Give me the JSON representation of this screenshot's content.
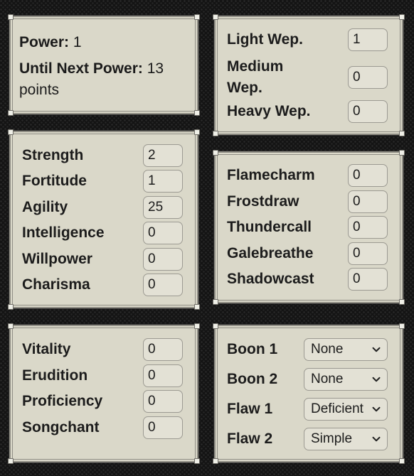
{
  "power_panel": {
    "power_label": "Power:",
    "power_value": "1",
    "next_label": "Until Next Power:",
    "next_value": "13 points"
  },
  "weapons_panel": {
    "items": [
      {
        "label": "Light Wep.",
        "value": "1"
      },
      {
        "label": "Medium Wep.",
        "value": "0"
      },
      {
        "label": "Heavy Wep.",
        "value": "0"
      }
    ]
  },
  "attributes_panel": {
    "items": [
      {
        "label": "Strength",
        "value": "2"
      },
      {
        "label": "Fortitude",
        "value": "1"
      },
      {
        "label": "Agility",
        "value": "25"
      },
      {
        "label": "Intelligence",
        "value": "0"
      },
      {
        "label": "Willpower",
        "value": "0"
      },
      {
        "label": "Charisma",
        "value": "0"
      }
    ]
  },
  "magic_panel": {
    "items": [
      {
        "label": "Flamecharm",
        "value": "0"
      },
      {
        "label": "Frostdraw",
        "value": "0"
      },
      {
        "label": "Thundercall",
        "value": "0"
      },
      {
        "label": "Galebreathe",
        "value": "0"
      },
      {
        "label": "Shadowcast",
        "value": "0"
      }
    ]
  },
  "skills_panel": {
    "items": [
      {
        "label": "Vitality",
        "value": "0"
      },
      {
        "label": "Erudition",
        "value": "0"
      },
      {
        "label": "Proficiency",
        "value": "0"
      },
      {
        "label": "Songchant",
        "value": "0"
      }
    ]
  },
  "traits_panel": {
    "items": [
      {
        "label": "Boon 1",
        "value": "None"
      },
      {
        "label": "Boon 2",
        "value": "None"
      },
      {
        "label": "Flaw 1",
        "value": "Deficient"
      },
      {
        "label": "Flaw 2",
        "value": "Simple"
      }
    ]
  },
  "icons": {
    "dropdown": "chevron-down-icon"
  },
  "colors": {
    "panel_bg": "#dad8c9",
    "page_bg": "#141414",
    "input_bg": "#e3e1d5"
  }
}
